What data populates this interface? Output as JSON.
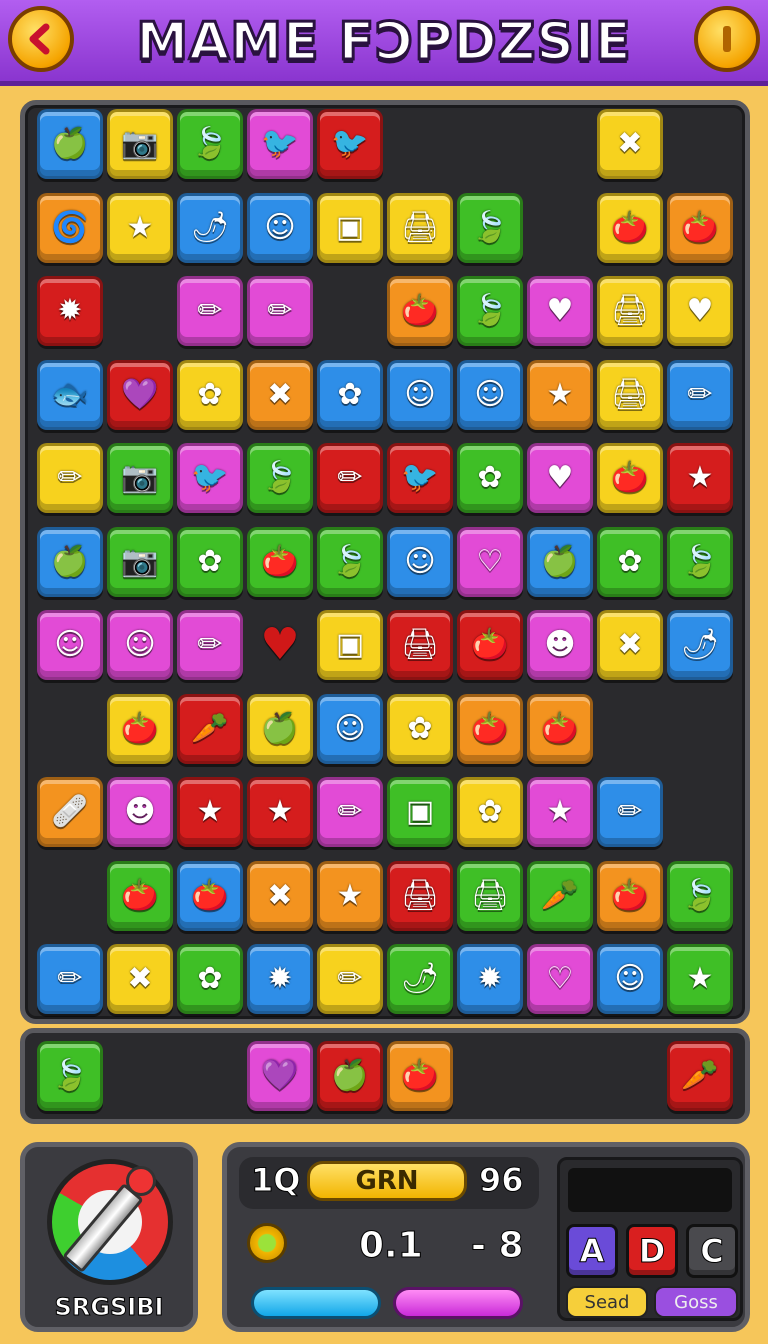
{
  "header": {
    "title": "MAME FƆPDZSIE",
    "back_icon": "chevron-left-icon",
    "info_icon": "info-icon"
  },
  "colors": {
    "blue": "#2e8ee8",
    "yellow": "#f7d21e",
    "green": "#3fbf26",
    "pink": "#e24bd6",
    "red": "#d51d1d",
    "orange": "#f3931f"
  },
  "board": {
    "tiles": [
      {
        "r": 0,
        "c": 0,
        "color": "blue",
        "icon": "apple-icon",
        "glyph": "🍏"
      },
      {
        "r": 0,
        "c": 1,
        "color": "yellow",
        "icon": "camera-icon",
        "glyph": "📷"
      },
      {
        "r": 0,
        "c": 2,
        "color": "green",
        "icon": "leaf-icon",
        "glyph": "🍃"
      },
      {
        "r": 0,
        "c": 3,
        "color": "pink",
        "icon": "bird-icon",
        "glyph": "🐦"
      },
      {
        "r": 0,
        "c": 4,
        "color": "red",
        "icon": "bird-icon",
        "glyph": "🐦"
      },
      {
        "r": 0,
        "c": 8,
        "color": "yellow",
        "icon": "cross-icon",
        "glyph": "✖"
      },
      {
        "r": 1,
        "c": 0,
        "color": "orange",
        "icon": "swirl-icon",
        "glyph": "🌀"
      },
      {
        "r": 1,
        "c": 1,
        "color": "yellow",
        "icon": "star-face-icon",
        "glyph": "★"
      },
      {
        "r": 1,
        "c": 2,
        "color": "blue",
        "icon": "pepper-icon",
        "glyph": "🌶"
      },
      {
        "r": 1,
        "c": 3,
        "color": "blue",
        "icon": "blob-icon",
        "glyph": "☺"
      },
      {
        "r": 1,
        "c": 4,
        "color": "yellow",
        "icon": "frame-icon",
        "glyph": "▣"
      },
      {
        "r": 1,
        "c": 5,
        "color": "yellow",
        "icon": "machine-icon",
        "glyph": "🖨"
      },
      {
        "r": 1,
        "c": 6,
        "color": "green",
        "icon": "leaf-icon",
        "glyph": "🍃"
      },
      {
        "r": 1,
        "c": 8,
        "color": "yellow",
        "icon": "tomato-icon",
        "glyph": "🍅"
      },
      {
        "r": 1,
        "c": 9,
        "color": "orange",
        "icon": "tomato-icon",
        "glyph": "🍅"
      },
      {
        "r": 2,
        "c": 0,
        "color": "red",
        "icon": "splat-icon",
        "glyph": "✹"
      },
      {
        "r": 2,
        "c": 2,
        "color": "pink",
        "icon": "pencil-icon",
        "glyph": "✏"
      },
      {
        "r": 2,
        "c": 3,
        "color": "pink",
        "icon": "pencil-icon",
        "glyph": "✏"
      },
      {
        "r": 2,
        "c": 5,
        "color": "orange",
        "icon": "tomato-icon",
        "glyph": "🍅"
      },
      {
        "r": 2,
        "c": 6,
        "color": "green",
        "icon": "leaf-icon",
        "glyph": "🍃"
      },
      {
        "r": 2,
        "c": 7,
        "color": "pink",
        "icon": "heart-icon",
        "glyph": "♥"
      },
      {
        "r": 2,
        "c": 8,
        "color": "yellow",
        "icon": "machine-icon",
        "glyph": "🖨"
      },
      {
        "r": 2,
        "c": 9,
        "color": "yellow",
        "icon": "heart-icon",
        "glyph": "♥"
      },
      {
        "r": 3,
        "c": 0,
        "color": "blue",
        "icon": "fish-icon",
        "glyph": "🐟"
      },
      {
        "r": 3,
        "c": 1,
        "color": "red",
        "icon": "heart-icon",
        "glyph": "💜"
      },
      {
        "r": 3,
        "c": 2,
        "color": "yellow",
        "icon": "flower-icon",
        "glyph": "✿"
      },
      {
        "r": 3,
        "c": 3,
        "color": "orange",
        "icon": "cross-icon",
        "glyph": "✖"
      },
      {
        "r": 3,
        "c": 4,
        "color": "blue",
        "icon": "flower-icon",
        "glyph": "✿"
      },
      {
        "r": 3,
        "c": 5,
        "color": "blue",
        "icon": "blob-icon",
        "glyph": "☺"
      },
      {
        "r": 3,
        "c": 6,
        "color": "blue",
        "icon": "blob-icon",
        "glyph": "☺"
      },
      {
        "r": 3,
        "c": 7,
        "color": "orange",
        "icon": "star-icon",
        "glyph": "★"
      },
      {
        "r": 3,
        "c": 8,
        "color": "yellow",
        "icon": "machine-icon",
        "glyph": "🖨"
      },
      {
        "r": 3,
        "c": 9,
        "color": "blue",
        "icon": "pencil-icon",
        "glyph": "✏"
      },
      {
        "r": 4,
        "c": 0,
        "color": "yellow",
        "icon": "pencil-icon",
        "glyph": "✏"
      },
      {
        "r": 4,
        "c": 1,
        "color": "green",
        "icon": "camera-icon",
        "glyph": "📷"
      },
      {
        "r": 4,
        "c": 2,
        "color": "pink",
        "icon": "bird-icon",
        "glyph": "🐦"
      },
      {
        "r": 4,
        "c": 3,
        "color": "green",
        "icon": "leaf-icon",
        "glyph": "🍃"
      },
      {
        "r": 4,
        "c": 4,
        "color": "red",
        "icon": "pencil-icon",
        "glyph": "✏"
      },
      {
        "r": 4,
        "c": 5,
        "color": "red",
        "icon": "bird-icon",
        "glyph": "🐦"
      },
      {
        "r": 4,
        "c": 6,
        "color": "green",
        "icon": "flower-icon",
        "glyph": "✿"
      },
      {
        "r": 4,
        "c": 7,
        "color": "pink",
        "icon": "heart-icon",
        "glyph": "♥"
      },
      {
        "r": 4,
        "c": 8,
        "color": "yellow",
        "icon": "tomato-icon",
        "glyph": "🍅"
      },
      {
        "r": 4,
        "c": 9,
        "color": "red",
        "icon": "star-icon",
        "glyph": "★"
      },
      {
        "r": 5,
        "c": 0,
        "color": "blue",
        "icon": "apple-icon",
        "glyph": "🍏"
      },
      {
        "r": 5,
        "c": 1,
        "color": "green",
        "icon": "camera-icon",
        "glyph": "📷"
      },
      {
        "r": 5,
        "c": 2,
        "color": "green",
        "icon": "flower-icon",
        "glyph": "✿"
      },
      {
        "r": 5,
        "c": 3,
        "color": "green",
        "icon": "tomato-icon",
        "glyph": "🍅"
      },
      {
        "r": 5,
        "c": 4,
        "color": "green",
        "icon": "leaf-icon",
        "glyph": "🍃"
      },
      {
        "r": 5,
        "c": 5,
        "color": "blue",
        "icon": "blob-icon",
        "glyph": "☺"
      },
      {
        "r": 5,
        "c": 6,
        "color": "pink",
        "icon": "heart-icon",
        "glyph": "♡"
      },
      {
        "r": 5,
        "c": 7,
        "color": "blue",
        "icon": "apple-icon",
        "glyph": "🍏"
      },
      {
        "r": 5,
        "c": 8,
        "color": "green",
        "icon": "flower-icon",
        "glyph": "✿"
      },
      {
        "r": 5,
        "c": 9,
        "color": "green",
        "icon": "leaf-icon",
        "glyph": "🍃"
      },
      {
        "r": 6,
        "c": 0,
        "color": "pink",
        "icon": "blob-icon",
        "glyph": "☺"
      },
      {
        "r": 6,
        "c": 1,
        "color": "pink",
        "icon": "blob-icon",
        "glyph": "☺"
      },
      {
        "r": 6,
        "c": 2,
        "color": "pink",
        "icon": "pencil-icon",
        "glyph": "✏"
      },
      {
        "r": 6,
        "c": 3,
        "color": "none",
        "icon": "heart-icon",
        "glyph": "♥"
      },
      {
        "r": 6,
        "c": 4,
        "color": "yellow",
        "icon": "frame-icon",
        "glyph": "▣"
      },
      {
        "r": 6,
        "c": 5,
        "color": "red",
        "icon": "machine-icon",
        "glyph": "🖨"
      },
      {
        "r": 6,
        "c": 6,
        "color": "red",
        "icon": "tomato-icon",
        "glyph": "🍅"
      },
      {
        "r": 6,
        "c": 7,
        "color": "pink",
        "icon": "moon-face-icon",
        "glyph": "☻"
      },
      {
        "r": 6,
        "c": 8,
        "color": "yellow",
        "icon": "cross-icon",
        "glyph": "✖"
      },
      {
        "r": 6,
        "c": 9,
        "color": "blue",
        "icon": "pepper-icon",
        "glyph": "🌶"
      },
      {
        "r": 7,
        "c": 1,
        "color": "yellow",
        "icon": "tomato-icon",
        "glyph": "🍅"
      },
      {
        "r": 7,
        "c": 2,
        "color": "red",
        "icon": "carrot-icon",
        "glyph": "🥕"
      },
      {
        "r": 7,
        "c": 3,
        "color": "yellow",
        "icon": "apple-icon",
        "glyph": "🍏"
      },
      {
        "r": 7,
        "c": 4,
        "color": "blue",
        "icon": "blob-icon",
        "glyph": "☺"
      },
      {
        "r": 7,
        "c": 5,
        "color": "yellow",
        "icon": "flower-icon",
        "glyph": "✿"
      },
      {
        "r": 7,
        "c": 6,
        "color": "orange",
        "icon": "tomato-icon",
        "glyph": "🍅"
      },
      {
        "r": 7,
        "c": 7,
        "color": "orange",
        "icon": "tomato-icon",
        "glyph": "🍅"
      },
      {
        "r": 8,
        "c": 0,
        "color": "orange",
        "icon": "bandage-icon",
        "glyph": "🩹"
      },
      {
        "r": 8,
        "c": 1,
        "color": "pink",
        "icon": "moon-face-icon",
        "glyph": "☻"
      },
      {
        "r": 8,
        "c": 2,
        "color": "red",
        "icon": "star-face-icon",
        "glyph": "★"
      },
      {
        "r": 8,
        "c": 3,
        "color": "red",
        "icon": "star-icon",
        "glyph": "★"
      },
      {
        "r": 8,
        "c": 4,
        "color": "pink",
        "icon": "pencil-icon",
        "glyph": "✏"
      },
      {
        "r": 8,
        "c": 5,
        "color": "green",
        "icon": "frame-icon",
        "glyph": "▣"
      },
      {
        "r": 8,
        "c": 6,
        "color": "yellow",
        "icon": "flower-icon",
        "glyph": "✿"
      },
      {
        "r": 8,
        "c": 7,
        "color": "pink",
        "icon": "star-icon",
        "glyph": "★"
      },
      {
        "r": 8,
        "c": 8,
        "color": "blue",
        "icon": "pencil-icon",
        "glyph": "✏"
      },
      {
        "r": 9,
        "c": 1,
        "color": "green",
        "icon": "tomato-icon",
        "glyph": "🍅"
      },
      {
        "r": 9,
        "c": 2,
        "color": "blue",
        "icon": "tomato-icon",
        "glyph": "🍅"
      },
      {
        "r": 9,
        "c": 3,
        "color": "orange",
        "icon": "cross-icon",
        "glyph": "✖"
      },
      {
        "r": 9,
        "c": 4,
        "color": "orange",
        "icon": "star-icon",
        "glyph": "★"
      },
      {
        "r": 9,
        "c": 5,
        "color": "red",
        "icon": "machine-icon",
        "glyph": "🖨"
      },
      {
        "r": 9,
        "c": 6,
        "color": "green",
        "icon": "machine-icon",
        "glyph": "🖨"
      },
      {
        "r": 9,
        "c": 7,
        "color": "green",
        "icon": "carrot-icon",
        "glyph": "🥕"
      },
      {
        "r": 9,
        "c": 8,
        "color": "orange",
        "icon": "tomato-icon",
        "glyph": "🍅"
      },
      {
        "r": 9,
        "c": 9,
        "color": "green",
        "icon": "leaf-icon",
        "glyph": "🍃"
      },
      {
        "r": 10,
        "c": 0,
        "color": "blue",
        "icon": "pencil-icon",
        "glyph": "✏"
      },
      {
        "r": 10,
        "c": 1,
        "color": "yellow",
        "icon": "cross-icon",
        "glyph": "✖"
      },
      {
        "r": 10,
        "c": 2,
        "color": "green",
        "icon": "flower-icon",
        "glyph": "✿"
      },
      {
        "r": 10,
        "c": 3,
        "color": "blue",
        "icon": "splat-icon",
        "glyph": "✹"
      },
      {
        "r": 10,
        "c": 4,
        "color": "yellow",
        "icon": "pencil-icon",
        "glyph": "✏"
      },
      {
        "r": 10,
        "c": 5,
        "color": "green",
        "icon": "pepper-icon",
        "glyph": "🌶"
      },
      {
        "r": 10,
        "c": 6,
        "color": "blue",
        "icon": "splat-icon",
        "glyph": "✹"
      },
      {
        "r": 10,
        "c": 7,
        "color": "pink",
        "icon": "heart-icon",
        "glyph": "♡"
      },
      {
        "r": 10,
        "c": 8,
        "color": "blue",
        "icon": "blob-icon",
        "glyph": "☺"
      },
      {
        "r": 10,
        "c": 9,
        "color": "green",
        "icon": "star-icon",
        "glyph": "★"
      }
    ]
  },
  "tray": {
    "tiles": [
      {
        "c": 0,
        "color": "green",
        "icon": "leaf-icon",
        "glyph": "🍃"
      },
      {
        "c": 3,
        "color": "pink",
        "icon": "heart-icon",
        "glyph": "💜"
      },
      {
        "c": 4,
        "color": "red",
        "icon": "apple-icon",
        "glyph": "🍏"
      },
      {
        "c": 5,
        "color": "orange",
        "icon": "tomato-icon",
        "glyph": "🍅"
      },
      {
        "c": 9,
        "color": "red",
        "icon": "carrot-icon",
        "glyph": "🥕"
      }
    ]
  },
  "tool": {
    "label": "SRGSIBI",
    "icon": "pen-tool-icon"
  },
  "stats": {
    "left_value": "1Q",
    "pill_label": "GRN",
    "right_value": "96",
    "coin_icon": "coin-icon",
    "value_a": "0.1",
    "value_b": "- 8",
    "bar_colors": [
      "#2ec0f5",
      "#e04be6"
    ]
  },
  "controls": {
    "key_a": "A",
    "key_d": "D",
    "key_c": "C",
    "seed_label": "Sead",
    "goss_label": "Goss"
  }
}
